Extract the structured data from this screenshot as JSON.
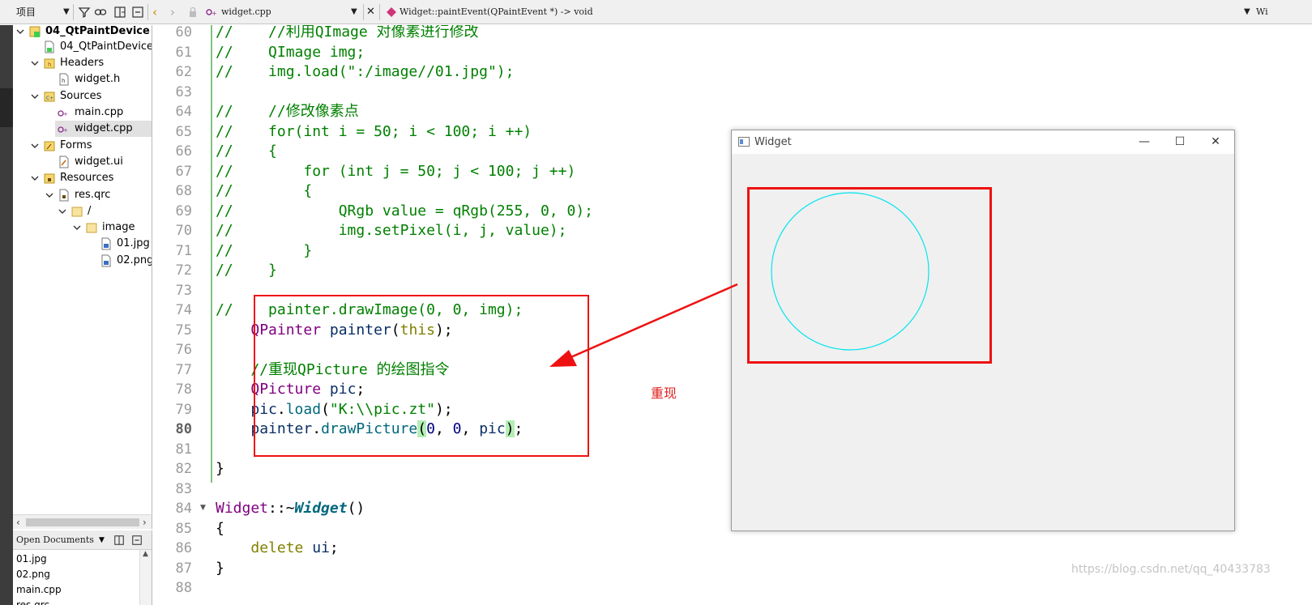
{
  "toolbar": {
    "project_label": "项目",
    "file_tab": "widget.cpp",
    "symbol": "Widget::paintEvent(QPaintEvent *) -> void",
    "right_cut": "Wi"
  },
  "tree": {
    "items": [
      {
        "label": "04_QtPaintDevice",
        "bold": true
      },
      {
        "label": "04_QtPaintDevice.p"
      },
      {
        "label": "Headers"
      },
      {
        "label": "widget.h"
      },
      {
        "label": "Sources"
      },
      {
        "label": "main.cpp"
      },
      {
        "label": "widget.cpp"
      },
      {
        "label": "Forms"
      },
      {
        "label": "widget.ui"
      },
      {
        "label": "Resources"
      },
      {
        "label": "res.qrc"
      },
      {
        "label": "/"
      },
      {
        "label": "image"
      },
      {
        "label": "01.jpg"
      },
      {
        "label": "02.png"
      }
    ]
  },
  "open_documents": {
    "title": "Open Documents",
    "items": [
      "01.jpg",
      "02.png",
      "main.cpp",
      "res.qrc"
    ]
  },
  "editor": {
    "line_numbers": [
      "60",
      "61",
      "62",
      "63",
      "64",
      "65",
      "66",
      "67",
      "68",
      "69",
      "70",
      "71",
      "72",
      "73",
      "74",
      "75",
      "76",
      "77",
      "78",
      "79",
      "80",
      "81",
      "82",
      "83",
      "84",
      "85",
      "86",
      "87",
      "88"
    ],
    "current_line": "80"
  },
  "annotation": {
    "label": "重现"
  },
  "widget_window": {
    "title": "Widget",
    "minimize": "—",
    "maximize": "☐",
    "close": "✕"
  },
  "watermark": "https://blog.csdn.net/qq_40433783",
  "colors": {
    "red_annotation": "#ee1111",
    "circle": "#00e5ee",
    "comment": "#008000",
    "type": "#800080",
    "keyword": "#808000"
  }
}
